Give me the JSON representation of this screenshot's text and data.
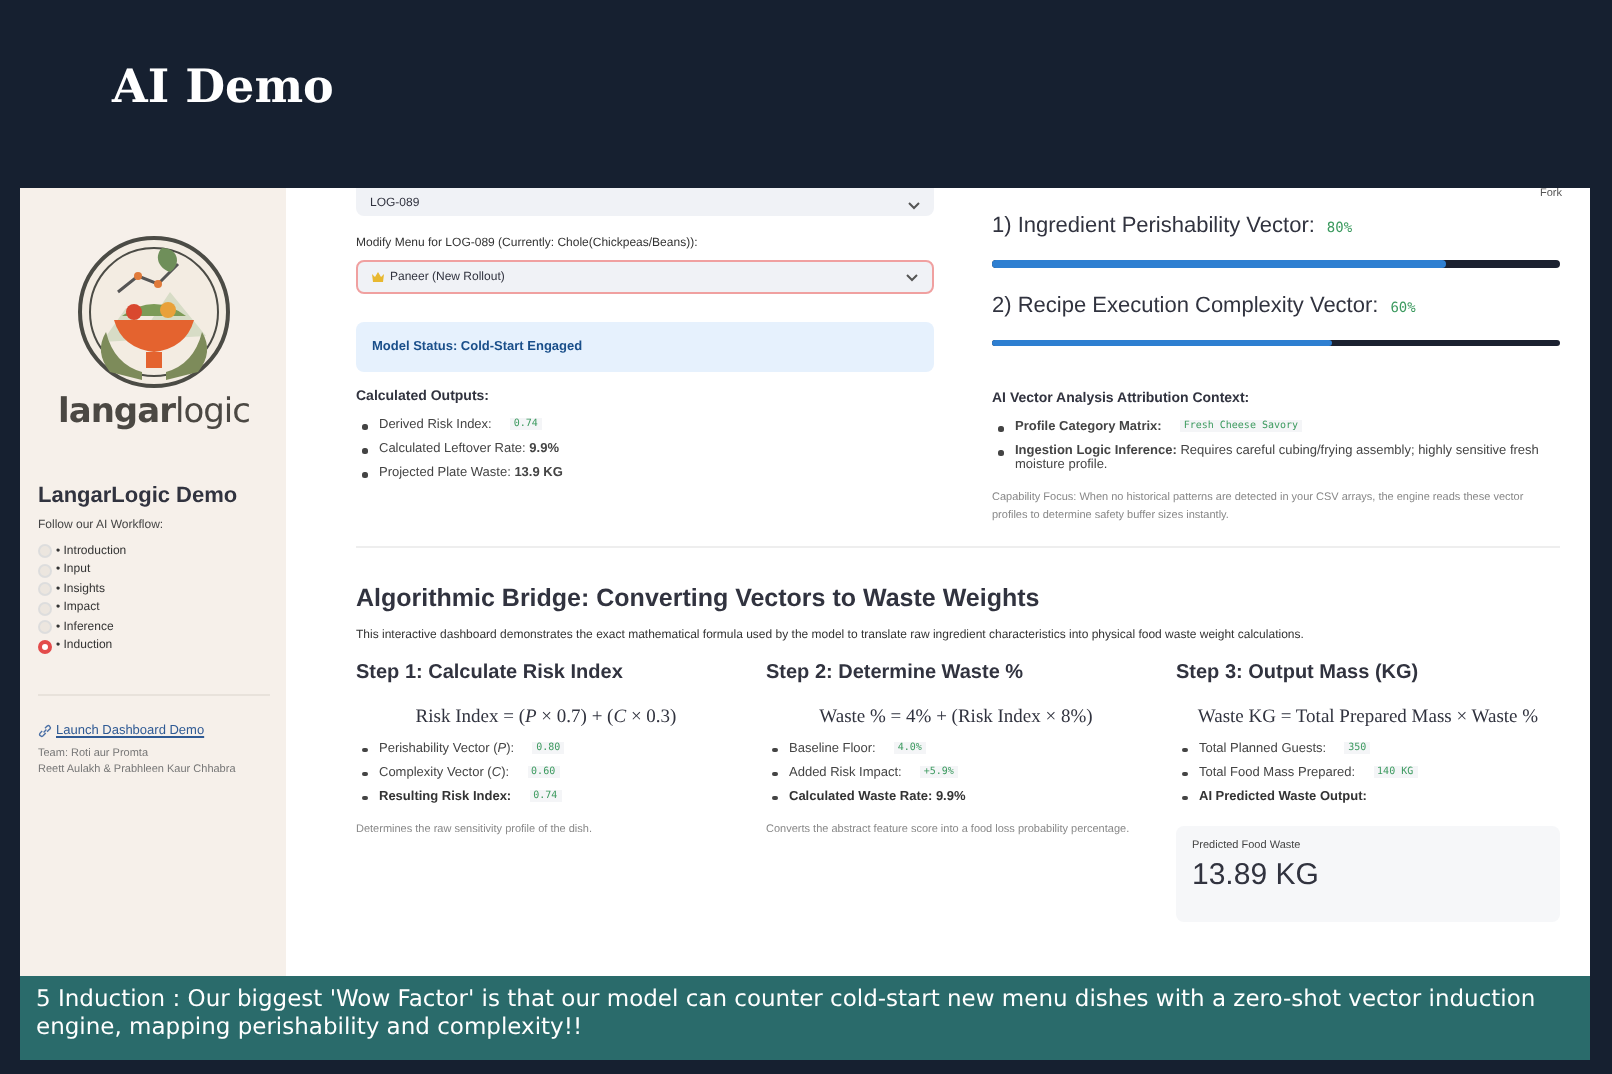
{
  "slide": {
    "title": "AI Demo",
    "caption": "5 Induction : Our biggest  'Wow Factor' is that our model can counter cold-start new menu dishes with a zero-shot vector induction engine, mapping perishability and complexity!!"
  },
  "sidebar": {
    "logo_text": "**langar**logic",
    "title": "LangarLogic Demo",
    "workflow_label": "Follow our AI Workflow:",
    "workflow": [
      {
        "label": "• Introduction",
        "selected": false
      },
      {
        "label": "• Input",
        "selected": false
      },
      {
        "label": "• Insights",
        "selected": false
      },
      {
        "label": "• Impact",
        "selected": false
      },
      {
        "label": "• Inference",
        "selected": false
      },
      {
        "label": "• Induction",
        "selected": true
      }
    ],
    "link": "Launch Dashboard Demo",
    "team": [
      "Team: Roti aur Promta",
      "Reett Aulakh & Prabhleen Kaur Chhabra"
    ]
  },
  "header": {
    "fork": "Fork"
  },
  "inputs": {
    "log_select": "LOG-089",
    "menu_label": "Modify Menu for LOG-089 (Currently: Chole(Chickpeas/Beans)):",
    "menu_select": "Paneer (New Rollout)"
  },
  "status": "Model Status: Cold-Start Engaged",
  "outputs": {
    "title": "Calculated Outputs:",
    "items": [
      {
        "label": "Derived Risk Index:",
        "code": "0.74"
      },
      {
        "label": "Calculated Leftover Rate: **9.9%**"
      },
      {
        "label": "Projected Plate Waste: **13.9 KG**"
      }
    ]
  },
  "vectors": [
    {
      "label": "1) Ingredient Perishability Vector:",
      "reading": "80%",
      "level": 0.8
    },
    {
      "label": "2) Recipe Execution Complexity Vector:",
      "reading": "60%",
      "level": 0.6
    }
  ],
  "attribution": {
    "title": "AI Vector Analysis Attribution Context:",
    "items": [
      {
        "label": "**Profile Category Matrix:**",
        "code": "Fresh Cheese Savory"
      },
      {
        "label": "**Ingestion Logic Inference:** Requires careful cubing/frying assembly; highly sensitive fresh moisture profile."
      }
    ],
    "note": "Capability Focus: When no historical patterns are detected in your CSV arrays, the engine reads these vector profiles to determine safety buffer sizes instantly."
  },
  "bridge": {
    "title": "Algorithmic Bridge: Converting Vectors to Waste Weights",
    "intro": "This interactive dashboard demonstrates the exact mathematical formula used by the model to translate raw ingredient characteristics into physical food waste weight calculations.",
    "steps": [
      {
        "title": "Step 1: Calculate Risk Index",
        "formula": "Risk Index = (*P* × 0.7) + (*C* × 0.3)",
        "items": [
          {
            "label": "Perishability Vector (*P*):",
            "code": "0.80",
            "bold": false
          },
          {
            "label": "Complexity Vector (*C*):",
            "code": "0.60",
            "bold": false
          },
          {
            "label": "Resulting Risk Index:",
            "code": "0.74",
            "bold": true
          }
        ],
        "note": "Determines the raw sensitivity profile of the dish."
      },
      {
        "title": "Step 2: Determine Waste %",
        "formula": "Waste % = 4% + (Risk Index × 8%)",
        "items": [
          {
            "label": "Baseline Floor:",
            "code": "4.0%",
            "bold": false
          },
          {
            "label": "Added Risk Impact:",
            "code": "+5.9%",
            "bold": false
          },
          {
            "label": "Calculated Waste Rate: 9.9%",
            "bold": true
          }
        ],
        "note": "Converts the abstract feature score into a food loss probability percentage."
      },
      {
        "title": "Step 3: Output Mass (KG)",
        "formula": "Waste KG = Total Prepared Mass × Waste %",
        "items": [
          {
            "label": "Total Planned Guests:",
            "code": "350",
            "bold": false
          },
          {
            "label": "Total Food Mass Prepared:",
            "code": "140 KG",
            "bold": false
          },
          {
            "label": "AI Predicted Waste Output:",
            "bold": true
          }
        ],
        "metric": {
          "label": "Predicted Food Waste",
          "value": "13.89 KG"
        }
      }
    ]
  }
}
